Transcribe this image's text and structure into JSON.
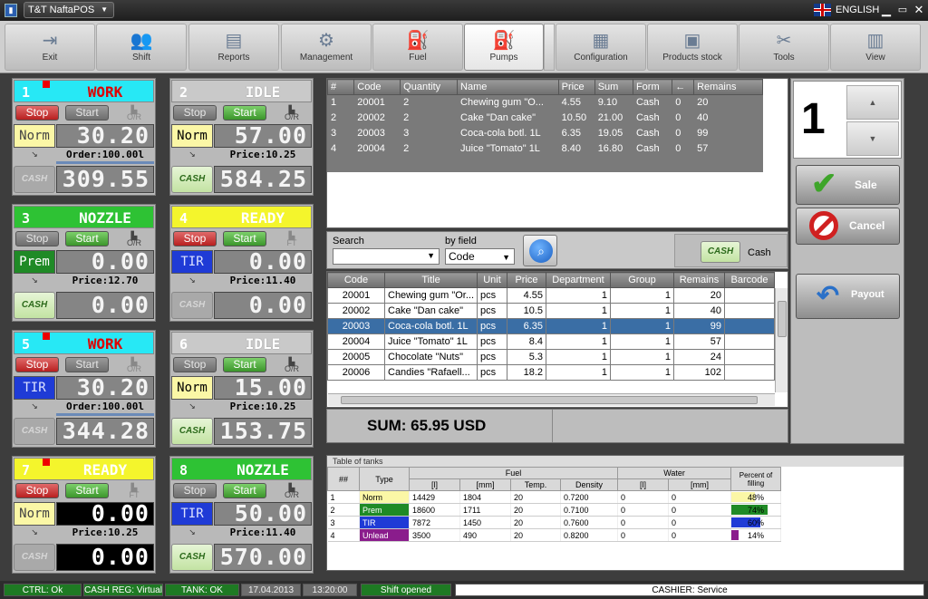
{
  "app": {
    "title": "T&T NaftaPOS",
    "language": "ENGLISH"
  },
  "toolbar": [
    {
      "label": "Exit",
      "icon": "exit-icon",
      "glyph": "⇥"
    },
    {
      "label": "Shift",
      "icon": "shift-icon",
      "glyph": "👥"
    },
    {
      "label": "Reports",
      "icon": "reports-icon",
      "glyph": "▤"
    },
    {
      "label": "Management",
      "icon": "management-icon",
      "glyph": "⚙"
    },
    {
      "label": "Fuel",
      "icon": "fuel-icon",
      "glyph": "⛽"
    },
    {
      "label": "Pumps",
      "icon": "pumps-icon",
      "glyph": "⛽"
    },
    {
      "label": "Configuration",
      "icon": "configuration-icon",
      "glyph": "▦"
    },
    {
      "label": "Products stock",
      "icon": "products-stock-icon",
      "glyph": "▣"
    },
    {
      "label": "Tools",
      "icon": "tools-icon",
      "glyph": "✂"
    },
    {
      "label": "View",
      "icon": "view-icon",
      "glyph": "▥"
    }
  ],
  "pumps": [
    {
      "num": "1",
      "status": "WORK",
      "header_color": "#27e8f5",
      "status_color": "#e00000",
      "flag": true,
      "stop": "Stop",
      "start": "Start",
      "or": "O/R",
      "fuel": "Norm",
      "fuel_color": "#fbf7a6",
      "fuel_text_color": "#444",
      "volume": "30.20",
      "info": "Order:100.00l",
      "amount": "309.55",
      "cash": "CASH"
    },
    {
      "num": "2",
      "status": "IDLE",
      "header_color": "#c9c9c9",
      "status_color": "#ffffff",
      "flag": false,
      "stop": "Stop",
      "start": "Start",
      "or": "O/R",
      "fuel": "Norm",
      "fuel_color": "#fbf7a6",
      "fuel_text_color": "#000",
      "volume": "57.00",
      "info": "Price:10.25",
      "amount": "584.25",
      "cash": "CASH"
    },
    {
      "num": "3",
      "status": "NOZZLE",
      "header_color": "#2ec234",
      "status_color": "#ffffff",
      "flag": false,
      "stop": "Stop",
      "start": "Start",
      "or": "O/R",
      "fuel": "Prem",
      "fuel_color": "#1f8a26",
      "fuel_text_color": "#ffffff",
      "volume": "0.00",
      "info": "Price:12.70",
      "amount": "0.00",
      "cash": "CASH"
    },
    {
      "num": "4",
      "status": "READY",
      "header_color": "#f4f52c",
      "status_color": "#ffffff",
      "flag": false,
      "stop": "Stop",
      "start": "Start",
      "or": "FT",
      "fuel": "TIR",
      "fuel_color": "#1f3bd6",
      "fuel_text_color": "#dde3ff",
      "volume": "0.00",
      "info": "Price:11.40",
      "amount": "0.00",
      "cash": "CASH"
    },
    {
      "num": "5",
      "status": "WORK",
      "header_color": "#27e8f5",
      "status_color": "#e00000",
      "flag": true,
      "stop": "Stop",
      "start": "Start",
      "or": "O/R",
      "fuel": "TIR",
      "fuel_color": "#1f3bd6",
      "fuel_text_color": "#dde3ff",
      "volume": "30.20",
      "info": "Order:100.00l",
      "amount": "344.28",
      "cash": "CASH"
    },
    {
      "num": "6",
      "status": "IDLE",
      "header_color": "#c9c9c9",
      "status_color": "#ffffff",
      "flag": false,
      "stop": "Stop",
      "start": "Start",
      "or": "O/R",
      "fuel": "Norm",
      "fuel_color": "#fbf7a6",
      "fuel_text_color": "#000",
      "volume": "15.00",
      "info": "Price:10.25",
      "amount": "153.75",
      "cash": "CASH"
    },
    {
      "num": "7",
      "status": "READY",
      "header_color": "#f4f52c",
      "status_color": "#ffffff",
      "flag": true,
      "stop": "Stop",
      "start": "Start",
      "or": "FT",
      "fuel": "Norm",
      "fuel_color": "#fbf7a6",
      "fuel_text_color": "#444",
      "volume": "0.00",
      "info": "Price:10.25",
      "amount": "0.00",
      "cash": "CASH"
    },
    {
      "num": "8",
      "status": "NOZZLE",
      "header_color": "#2ec234",
      "status_color": "#ffffff",
      "flag": false,
      "stop": "Stop",
      "start": "Start",
      "or": "O/R",
      "fuel": "TIR",
      "fuel_color": "#1f3bd6",
      "fuel_text_color": "#dde3ff",
      "volume": "50.00",
      "info": "Price:11.40",
      "amount": "570.00",
      "cash": "CASH"
    }
  ],
  "receipt": {
    "headers": [
      "#",
      "Code",
      "Quantity",
      "Name",
      "Price",
      "Sum",
      "Form",
      "←",
      "Remains"
    ],
    "rows": [
      [
        "1",
        "20001",
        "2",
        "Chewing gum \"O...",
        "4.55",
        "9.10",
        "Cash",
        "0",
        "20"
      ],
      [
        "2",
        "20002",
        "2",
        "Cake \"Dan cake\"",
        "10.50",
        "21.00",
        "Cash",
        "0",
        "40"
      ],
      [
        "3",
        "20003",
        "3",
        "Coca-cola botl. 1L",
        "6.35",
        "19.05",
        "Cash",
        "0",
        "99"
      ],
      [
        "4",
        "20004",
        "2",
        "Juice \"Tomato\" 1L",
        "8.40",
        "16.80",
        "Cash",
        "0",
        "57"
      ]
    ]
  },
  "search": {
    "label": "Search",
    "by_field_label": "by field",
    "by_field_value": "Code",
    "cash_label": "Cash",
    "cash_btn": "CASH"
  },
  "products": {
    "headers": [
      "Code",
      "Title",
      "Unit",
      "Price",
      "Department",
      "Group",
      "Remains",
      "Barcode"
    ],
    "rows": [
      [
        "20001",
        "Chewing gum \"Or...",
        "pcs",
        "4.55",
        "1",
        "1",
        "20",
        ""
      ],
      [
        "20002",
        "Cake \"Dan cake\"",
        "pcs",
        "10.5",
        "1",
        "1",
        "40",
        ""
      ],
      [
        "20003",
        "Coca-cola botl. 1L",
        "pcs",
        "6.35",
        "1",
        "1",
        "99",
        ""
      ],
      [
        "20004",
        "Juice \"Tomato\" 1L",
        "pcs",
        "8.4",
        "1",
        "1",
        "57",
        ""
      ],
      [
        "20005",
        "Chocolate \"Nuts\"",
        "pcs",
        "5.3",
        "1",
        "1",
        "24",
        ""
      ],
      [
        "20006",
        "Candies \"Rafaell...",
        "pcs",
        "18.2",
        "1",
        "1",
        "102",
        ""
      ]
    ],
    "selected_row": 2
  },
  "sum": "SUM: 65.95 USD",
  "right": {
    "pump_number": "1",
    "sale": "Sale",
    "cancel": "Cancel",
    "payout": "Payout"
  },
  "tanks": {
    "title": "Table of tanks",
    "h_num": "##",
    "h_type": "Type",
    "h_fuel": "Fuel",
    "h_water": "Water",
    "h_percent": "Percent of filling",
    "h_l": "[l]",
    "h_mm": "[mm]",
    "h_temp": "Temp.",
    "h_density": "Density",
    "h_wl": "[l]",
    "h_wmm": "[mm]",
    "rows": [
      {
        "n": "1",
        "type": "Norm",
        "color": "#fbf7a6",
        "text": "#000",
        "l": "14429",
        "mm": "1804",
        "temp": "20",
        "density": "0.7200",
        "wl": "0",
        "wmm": "0",
        "pct": "48%",
        "fill": 0.48
      },
      {
        "n": "2",
        "type": "Prem",
        "color": "#1f8a26",
        "text": "#fff",
        "l": "18600",
        "mm": "1711",
        "temp": "20",
        "density": "0.7100",
        "wl": "0",
        "wmm": "0",
        "pct": "74%",
        "fill": 0.74
      },
      {
        "n": "3",
        "type": "TIR",
        "color": "#1f3bd6",
        "text": "#fff",
        "l": "7872",
        "mm": "1450",
        "temp": "20",
        "density": "0.7600",
        "wl": "0",
        "wmm": "0",
        "pct": "60%",
        "fill": 0.6
      },
      {
        "n": "4",
        "type": "Unlead",
        "color": "#8a1c8c",
        "text": "#fff",
        "l": "3500",
        "mm": "490",
        "temp": "20",
        "density": "0.8200",
        "wl": "0",
        "wmm": "0",
        "pct": "14%",
        "fill": 0.14
      }
    ]
  },
  "status": {
    "ctrl": "CTRL: Ok",
    "cashreg": "CASH REG: Virtual",
    "tank": "TANK: OK",
    "date": "17.04.2013",
    "time": "13:20:00",
    "shift": "Shift opened",
    "cashier": "CASHIER: Service"
  }
}
